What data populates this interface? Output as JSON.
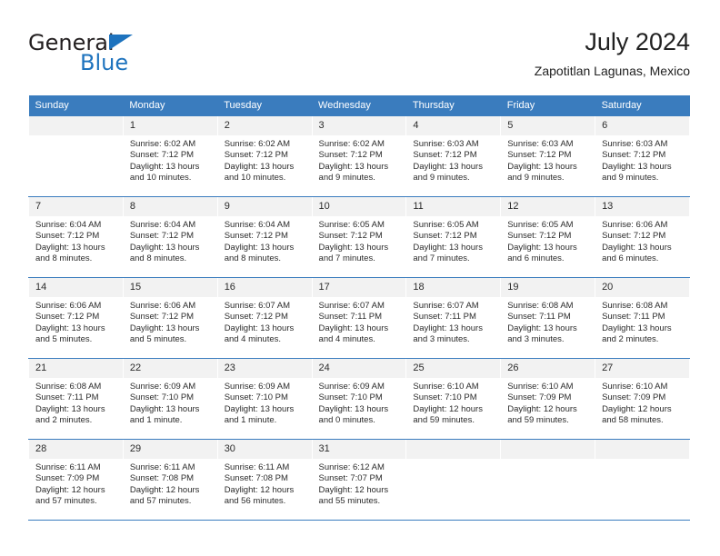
{
  "brand": {
    "name_part1": "General",
    "name_part2": "Blue",
    "triangle_color": "#1e73be"
  },
  "header": {
    "title": "July 2024",
    "subtitle": "Zapotitlan Lagunas, Mexico"
  },
  "colors": {
    "header_row_bg": "#3a7cbe",
    "daynum_bg": "#f2f2f2",
    "text": "#2b2b2b"
  },
  "weekdays": [
    "Sunday",
    "Monday",
    "Tuesday",
    "Wednesday",
    "Thursday",
    "Friday",
    "Saturday"
  ],
  "weeks": [
    [
      {
        "day": "",
        "blank": true,
        "sunrise": "",
        "sunset": "",
        "daylight_line1": "",
        "daylight_line2": ""
      },
      {
        "day": "1",
        "sunrise": "Sunrise: 6:02 AM",
        "sunset": "Sunset: 7:12 PM",
        "daylight_line1": "Daylight: 13 hours",
        "daylight_line2": "and 10 minutes."
      },
      {
        "day": "2",
        "sunrise": "Sunrise: 6:02 AM",
        "sunset": "Sunset: 7:12 PM",
        "daylight_line1": "Daylight: 13 hours",
        "daylight_line2": "and 10 minutes."
      },
      {
        "day": "3",
        "sunrise": "Sunrise: 6:02 AM",
        "sunset": "Sunset: 7:12 PM",
        "daylight_line1": "Daylight: 13 hours",
        "daylight_line2": "and 9 minutes."
      },
      {
        "day": "4",
        "sunrise": "Sunrise: 6:03 AM",
        "sunset": "Sunset: 7:12 PM",
        "daylight_line1": "Daylight: 13 hours",
        "daylight_line2": "and 9 minutes."
      },
      {
        "day": "5",
        "sunrise": "Sunrise: 6:03 AM",
        "sunset": "Sunset: 7:12 PM",
        "daylight_line1": "Daylight: 13 hours",
        "daylight_line2": "and 9 minutes."
      },
      {
        "day": "6",
        "sunrise": "Sunrise: 6:03 AM",
        "sunset": "Sunset: 7:12 PM",
        "daylight_line1": "Daylight: 13 hours",
        "daylight_line2": "and 9 minutes."
      }
    ],
    [
      {
        "day": "7",
        "sunrise": "Sunrise: 6:04 AM",
        "sunset": "Sunset: 7:12 PM",
        "daylight_line1": "Daylight: 13 hours",
        "daylight_line2": "and 8 minutes."
      },
      {
        "day": "8",
        "sunrise": "Sunrise: 6:04 AM",
        "sunset": "Sunset: 7:12 PM",
        "daylight_line1": "Daylight: 13 hours",
        "daylight_line2": "and 8 minutes."
      },
      {
        "day": "9",
        "sunrise": "Sunrise: 6:04 AM",
        "sunset": "Sunset: 7:12 PM",
        "daylight_line1": "Daylight: 13 hours",
        "daylight_line2": "and 8 minutes."
      },
      {
        "day": "10",
        "sunrise": "Sunrise: 6:05 AM",
        "sunset": "Sunset: 7:12 PM",
        "daylight_line1": "Daylight: 13 hours",
        "daylight_line2": "and 7 minutes."
      },
      {
        "day": "11",
        "sunrise": "Sunrise: 6:05 AM",
        "sunset": "Sunset: 7:12 PM",
        "daylight_line1": "Daylight: 13 hours",
        "daylight_line2": "and 7 minutes."
      },
      {
        "day": "12",
        "sunrise": "Sunrise: 6:05 AM",
        "sunset": "Sunset: 7:12 PM",
        "daylight_line1": "Daylight: 13 hours",
        "daylight_line2": "and 6 minutes."
      },
      {
        "day": "13",
        "sunrise": "Sunrise: 6:06 AM",
        "sunset": "Sunset: 7:12 PM",
        "daylight_line1": "Daylight: 13 hours",
        "daylight_line2": "and 6 minutes."
      }
    ],
    [
      {
        "day": "14",
        "sunrise": "Sunrise: 6:06 AM",
        "sunset": "Sunset: 7:12 PM",
        "daylight_line1": "Daylight: 13 hours",
        "daylight_line2": "and 5 minutes."
      },
      {
        "day": "15",
        "sunrise": "Sunrise: 6:06 AM",
        "sunset": "Sunset: 7:12 PM",
        "daylight_line1": "Daylight: 13 hours",
        "daylight_line2": "and 5 minutes."
      },
      {
        "day": "16",
        "sunrise": "Sunrise: 6:07 AM",
        "sunset": "Sunset: 7:12 PM",
        "daylight_line1": "Daylight: 13 hours",
        "daylight_line2": "and 4 minutes."
      },
      {
        "day": "17",
        "sunrise": "Sunrise: 6:07 AM",
        "sunset": "Sunset: 7:11 PM",
        "daylight_line1": "Daylight: 13 hours",
        "daylight_line2": "and 4 minutes."
      },
      {
        "day": "18",
        "sunrise": "Sunrise: 6:07 AM",
        "sunset": "Sunset: 7:11 PM",
        "daylight_line1": "Daylight: 13 hours",
        "daylight_line2": "and 3 minutes."
      },
      {
        "day": "19",
        "sunrise": "Sunrise: 6:08 AM",
        "sunset": "Sunset: 7:11 PM",
        "daylight_line1": "Daylight: 13 hours",
        "daylight_line2": "and 3 minutes."
      },
      {
        "day": "20",
        "sunrise": "Sunrise: 6:08 AM",
        "sunset": "Sunset: 7:11 PM",
        "daylight_line1": "Daylight: 13 hours",
        "daylight_line2": "and 2 minutes."
      }
    ],
    [
      {
        "day": "21",
        "sunrise": "Sunrise: 6:08 AM",
        "sunset": "Sunset: 7:11 PM",
        "daylight_line1": "Daylight: 13 hours",
        "daylight_line2": "and 2 minutes."
      },
      {
        "day": "22",
        "sunrise": "Sunrise: 6:09 AM",
        "sunset": "Sunset: 7:10 PM",
        "daylight_line1": "Daylight: 13 hours",
        "daylight_line2": "and 1 minute."
      },
      {
        "day": "23",
        "sunrise": "Sunrise: 6:09 AM",
        "sunset": "Sunset: 7:10 PM",
        "daylight_line1": "Daylight: 13 hours",
        "daylight_line2": "and 1 minute."
      },
      {
        "day": "24",
        "sunrise": "Sunrise: 6:09 AM",
        "sunset": "Sunset: 7:10 PM",
        "daylight_line1": "Daylight: 13 hours",
        "daylight_line2": "and 0 minutes."
      },
      {
        "day": "25",
        "sunrise": "Sunrise: 6:10 AM",
        "sunset": "Sunset: 7:10 PM",
        "daylight_line1": "Daylight: 12 hours",
        "daylight_line2": "and 59 minutes."
      },
      {
        "day": "26",
        "sunrise": "Sunrise: 6:10 AM",
        "sunset": "Sunset: 7:09 PM",
        "daylight_line1": "Daylight: 12 hours",
        "daylight_line2": "and 59 minutes."
      },
      {
        "day": "27",
        "sunrise": "Sunrise: 6:10 AM",
        "sunset": "Sunset: 7:09 PM",
        "daylight_line1": "Daylight: 12 hours",
        "daylight_line2": "and 58 minutes."
      }
    ],
    [
      {
        "day": "28",
        "sunrise": "Sunrise: 6:11 AM",
        "sunset": "Sunset: 7:09 PM",
        "daylight_line1": "Daylight: 12 hours",
        "daylight_line2": "and 57 minutes."
      },
      {
        "day": "29",
        "sunrise": "Sunrise: 6:11 AM",
        "sunset": "Sunset: 7:08 PM",
        "daylight_line1": "Daylight: 12 hours",
        "daylight_line2": "and 57 minutes."
      },
      {
        "day": "30",
        "sunrise": "Sunrise: 6:11 AM",
        "sunset": "Sunset: 7:08 PM",
        "daylight_line1": "Daylight: 12 hours",
        "daylight_line2": "and 56 minutes."
      },
      {
        "day": "31",
        "sunrise": "Sunrise: 6:12 AM",
        "sunset": "Sunset: 7:07 PM",
        "daylight_line1": "Daylight: 12 hours",
        "daylight_line2": "and 55 minutes."
      },
      {
        "day": "",
        "blank": true,
        "empty_cell": true,
        "sunrise": "",
        "sunset": "",
        "daylight_line1": "",
        "daylight_line2": ""
      },
      {
        "day": "",
        "blank": true,
        "empty_cell": true,
        "sunrise": "",
        "sunset": "",
        "daylight_line1": "",
        "daylight_line2": ""
      },
      {
        "day": "",
        "blank": true,
        "empty_cell": true,
        "sunrise": "",
        "sunset": "",
        "daylight_line1": "",
        "daylight_line2": ""
      }
    ]
  ]
}
